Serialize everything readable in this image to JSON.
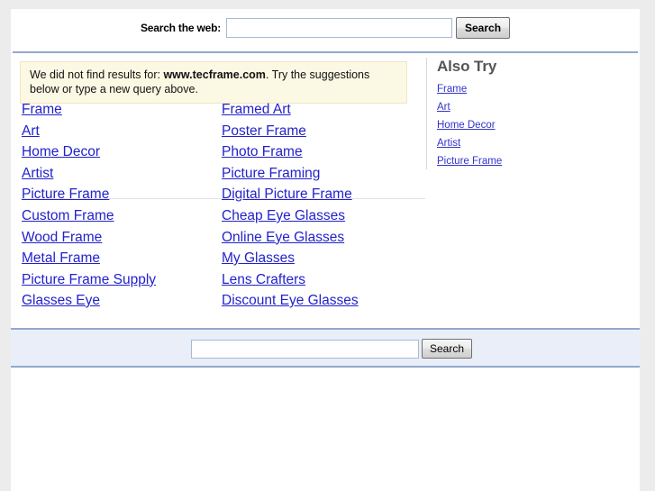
{
  "top_search": {
    "label": "Search the web:",
    "query_value": "",
    "query_placeholder": "",
    "button_label": "Search"
  },
  "notice": {
    "prefix": "We did not find results for: ",
    "query": "www.tecframe.com",
    "suffix": ". Try the suggestions below or type a new query above."
  },
  "suggestions": {
    "group_1": {
      "left": [
        "Frame",
        "Art",
        "Home Decor",
        "Artist",
        "Picture Frame"
      ],
      "right": [
        "Framed Art",
        "Poster Frame",
        "Photo Frame",
        "Picture Framing",
        "Digital Picture Frame"
      ]
    },
    "group_2": {
      "left": [
        "Custom Frame",
        "Wood Frame",
        "Metal Frame",
        "Picture Frame Supply",
        "Glasses Eye"
      ],
      "right": [
        "Cheap Eye Glasses",
        "Online Eye Glasses",
        "My Glasses",
        "Lens Crafters",
        "Discount Eye Glasses"
      ]
    }
  },
  "sidebar": {
    "title": "Also Try",
    "links": [
      "Frame",
      "Art",
      "Home Decor",
      "Artist",
      "Picture Frame"
    ]
  },
  "bottom_search": {
    "query_value": "",
    "query_placeholder": "",
    "button_label": "Search"
  },
  "colors": {
    "link": "#2222cc",
    "sidebar_link": "#3333cc",
    "notice_bg": "#fbf8e3",
    "notice_border": "#efe6c4",
    "rule": "#92a9cb",
    "bottom_bar_bg": "#e9eef8",
    "page_bg": "#ececec"
  }
}
